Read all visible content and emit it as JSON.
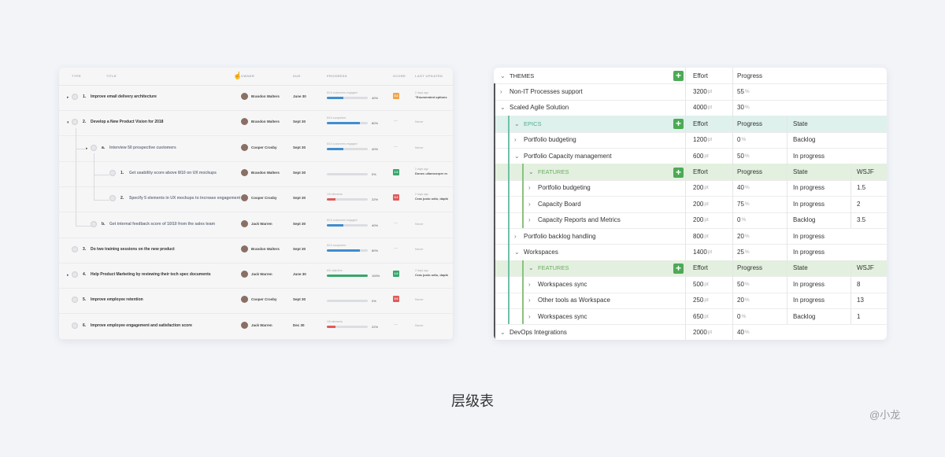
{
  "left_table": {
    "headers": {
      "type": "TYPE",
      "title": "TITLE",
      "owner": "OWNER",
      "due": "DUE",
      "progress": "PROGRESS",
      "score": "SCORE",
      "last_updated": "LAST UPDATED"
    },
    "rows": [
      {
        "caret": "▸",
        "num": "1.",
        "title": "Improve email delivery architecture",
        "owner": "Brandon Walters",
        "due": "June 30",
        "caption": "8/10 customers engaged",
        "progress": 0.4,
        "pct": "40%",
        "color": "#3e8ed0",
        "badge": "0.4",
        "badge_color": "#f0a54a",
        "upd1": "2 days ago",
        "upd2": "\"Enumerated options"
      },
      {
        "caret": "▾",
        "num": "2.",
        "title": "Develop a New Product Vision for 2018",
        "owner": "Brandon Walters",
        "due": "Sept 30",
        "caption": "8/10 completed",
        "progress": 0.8,
        "pct": "80%",
        "color": "#3e8ed0",
        "badge": "",
        "badge_color": "",
        "upd1": "",
        "upd2": "Never"
      },
      {
        "caret": "▸",
        "num": "a.",
        "title": "Interview 50 prospective customers",
        "owner": "Cooper Crosby",
        "due": "Sept 30",
        "caption": "8/10 customers engaged",
        "progress": 0.4,
        "pct": "40%",
        "color": "#3e8ed0",
        "badge": "",
        "badge_color": "",
        "upd1": "",
        "upd2": "Never"
      },
      {
        "caret": "",
        "num": "1.",
        "title": "Get usability score above 8/10 on UX mockups",
        "owner": "Brandon Walters",
        "due": "Sept 30",
        "caption": "",
        "progress": 0,
        "pct": "0%",
        "color": "#3e8ed0",
        "badge": "1.0",
        "badge_color": "#3aa66b",
        "upd1": "2 days ago",
        "upd2": "Donec ullamcorper m"
      },
      {
        "caret": "",
        "num": "2.",
        "title": "Specify 5 elements in UX mockups to increase engagement",
        "owner": "Cooper Crosby",
        "due": "Sept 30",
        "caption": "1/5 elements",
        "progress": 0.22,
        "pct": "22%",
        "color": "#e05a5a",
        "badge": "0.2",
        "badge_color": "#e05a5a",
        "upd1": "2 days ago",
        "upd2": "Cras justo odio, dapib"
      },
      {
        "caret": "",
        "num": "b.",
        "title": "Get internal feedback score of 10/10 from the sales team",
        "owner": "Jack Warren",
        "due": "Sept 30",
        "caption": "8/10 customers engaged",
        "progress": 0.4,
        "pct": "40%",
        "color": "#3e8ed0",
        "badge": "",
        "badge_color": "",
        "upd1": "",
        "upd2": "Never"
      },
      {
        "caret": "",
        "num": "3.",
        "title": "Do two training sessions on the new product",
        "owner": "Brandon Walters",
        "due": "Sept 30",
        "caption": "8/10 completed",
        "progress": 0.8,
        "pct": "80%",
        "color": "#3e8ed0",
        "badge": "",
        "badge_color": "",
        "upd1": "",
        "upd2": "Never"
      },
      {
        "caret": "▸",
        "num": "4.",
        "title": "Help Product Marketing by reviewing their tech spec documents",
        "owner": "Jack Warren",
        "due": "June 30",
        "caption": "6/6 objective",
        "progress": 1.0,
        "pct": "100%",
        "color": "#3aa66b",
        "badge": "1.0",
        "badge_color": "#3aa66b",
        "upd1": "2 days ago",
        "upd2": "Cras justo odio, dapib"
      },
      {
        "caret": "",
        "num": "5.",
        "title": "Improve employee retention",
        "owner": "Cooper Crosby",
        "due": "Sept 30",
        "caption": "",
        "progress": 0,
        "pct": "0%",
        "color": "#3e8ed0",
        "badge": "0.0",
        "badge_color": "#e05a5a",
        "upd1": "",
        "upd2": "Never"
      },
      {
        "caret": "",
        "num": "6.",
        "title": "Improve employee engagement and satisfaction score",
        "owner": "Jack Warren",
        "due": "Dec 30",
        "caption": "1/5 elements",
        "progress": 0.22,
        "pct": "22%",
        "color": "#e05a5a",
        "badge": "",
        "badge_color": "",
        "upd1": "",
        "upd2": "Never"
      }
    ]
  },
  "right_table": {
    "rows": [
      {
        "kind": "header",
        "chev": "⌄",
        "label": "THEMES",
        "plus": true,
        "cols": [
          "Effort",
          "Progress"
        ]
      },
      {
        "kind": "item",
        "chev": "›",
        "label": "Non-IT Processes support",
        "effort": "3200",
        "progress": "55",
        "bar": "#555"
      },
      {
        "kind": "item",
        "chev": "⌄",
        "label": "Scaled Agile Solution",
        "effort": "4000",
        "progress": "30",
        "bar": "#555"
      },
      {
        "kind": "header",
        "chev": "⌄",
        "label": "EPICS",
        "plus": true,
        "cols": [
          "Effort",
          "Progress",
          "State"
        ],
        "tint": "#dff1ec",
        "textcolor": "#4caf8f"
      },
      {
        "kind": "item",
        "chev": "›",
        "label": "Portfolio budgeting",
        "effort": "1200",
        "progress": "0",
        "state": "Backlog",
        "bar": "#6fc0a8"
      },
      {
        "kind": "item",
        "chev": "⌄",
        "label": "Portfolio Capacity management",
        "effort": "600",
        "progress": "50",
        "state": "In progress",
        "bar": "#6fc0a8"
      },
      {
        "kind": "header",
        "chev": "⌄",
        "label": "FEATURES",
        "plus": true,
        "cols": [
          "Effort",
          "Progress",
          "State",
          "WSJF"
        ],
        "tint": "#e3f0df",
        "textcolor": "#6aae5e"
      },
      {
        "kind": "item",
        "chev": "›",
        "label": "Portfolio budgeting",
        "effort": "200",
        "progress": "40",
        "state": "In progress",
        "wsjf": "1.5",
        "bar": "#8cc27e"
      },
      {
        "kind": "item",
        "chev": "›",
        "label": "Capacity Board",
        "effort": "200",
        "progress": "75",
        "state": "In progress",
        "wsjf": "2",
        "bar": "#8cc27e"
      },
      {
        "kind": "item",
        "chev": "›",
        "label": "Capacity Reports and Metrics",
        "effort": "200",
        "progress": "0",
        "state": "Backlog",
        "wsjf": "3.5",
        "bar": "#8cc27e"
      },
      {
        "kind": "item",
        "chev": "›",
        "label": "Portfolio backlog handling",
        "effort": "800",
        "progress": "20",
        "state": "In progress",
        "bar": "#6fc0a8"
      },
      {
        "kind": "item",
        "chev": "⌄",
        "label": "Workspaces",
        "effort": "1400",
        "progress": "25",
        "state": "In progress",
        "bar": "#6fc0a8"
      },
      {
        "kind": "header",
        "chev": "⌄",
        "label": "FEATURES",
        "plus": true,
        "cols": [
          "Effort",
          "Progress",
          "State",
          "WSJF"
        ],
        "tint": "#e3f0df",
        "textcolor": "#6aae5e"
      },
      {
        "kind": "item",
        "chev": "›",
        "label": "Workspaces sync",
        "effort": "500",
        "progress": "50",
        "state": "In progress",
        "wsjf": "8",
        "bar": "#8cc27e"
      },
      {
        "kind": "item",
        "chev": "›",
        "label": "Other tools as Workspace",
        "effort": "250",
        "progress": "20",
        "state": "In progress",
        "wsjf": "13",
        "bar": "#8cc27e"
      },
      {
        "kind": "item",
        "chev": "›",
        "label": "Workspaces sync",
        "effort": "650",
        "progress": "0",
        "state": "Backlog",
        "wsjf": "1",
        "bar": "#8cc27e"
      },
      {
        "kind": "item",
        "chev": "⌄",
        "label": "DevOps Integrations",
        "effort": "2000",
        "progress": "40",
        "bar": "#555"
      }
    ],
    "unit_pt": "pt",
    "unit_pct": "%"
  },
  "caption": "层级表",
  "watermark": "@小龙"
}
